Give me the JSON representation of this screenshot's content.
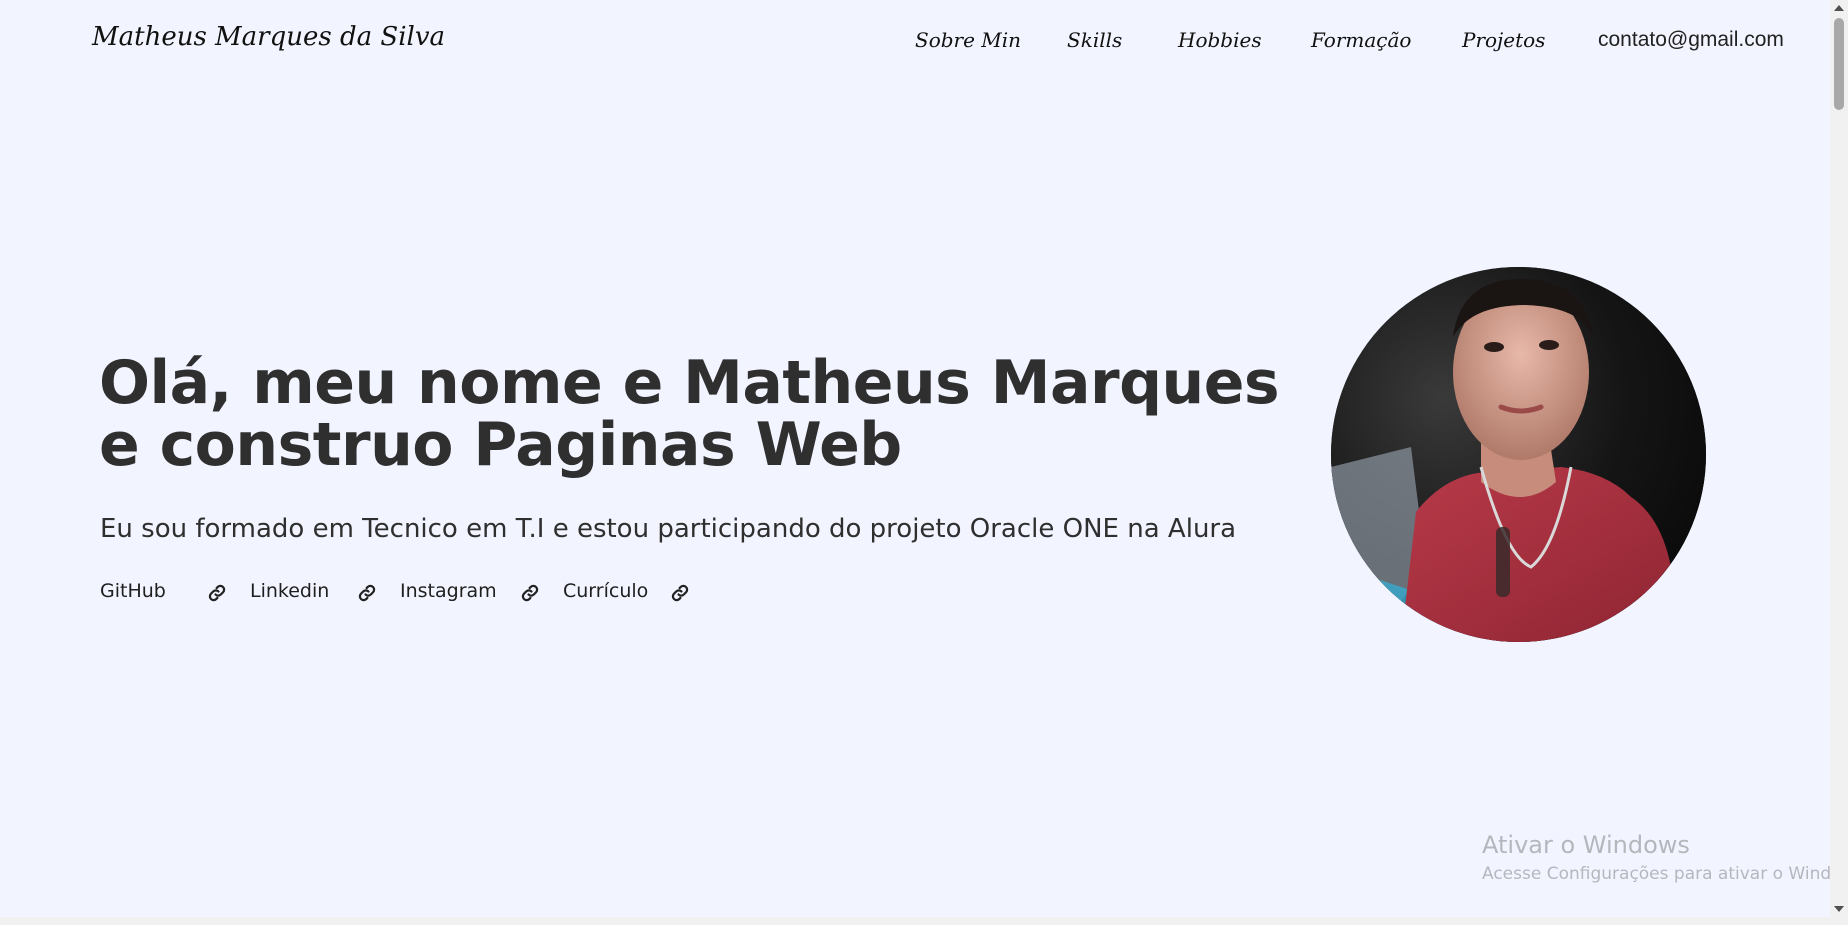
{
  "header": {
    "logo": "Matheus Marques da Silva",
    "nav": {
      "items": [
        {
          "label": "Sobre Min"
        },
        {
          "label": "Skills"
        },
        {
          "label": "Hobbies"
        },
        {
          "label": "Formação"
        },
        {
          "label": "Projetos"
        }
      ],
      "email": "contato@gmail.com"
    }
  },
  "hero": {
    "title": "Olá, meu nome e Matheus Marques e construo Paginas Web",
    "subtitle": "Eu sou formado em Tecnico em T.I e estou participando do projeto Oracle ONE na Alura",
    "links": [
      {
        "label": "GitHub",
        "icon": "link-icon"
      },
      {
        "label": "Linkedin",
        "icon": "link-icon"
      },
      {
        "label": "Instagram",
        "icon": "link-icon"
      },
      {
        "label": "Currículo",
        "icon": "link-icon"
      }
    ]
  },
  "watermark": {
    "title": "Ativar o Windows",
    "subtitle": "Acesse Configurações para ativar o Windows."
  },
  "colors": {
    "background": "#f2f4ff",
    "text": "#2f2f2f",
    "watermark": "#b6b7bd",
    "shirt": "#a3303d"
  }
}
